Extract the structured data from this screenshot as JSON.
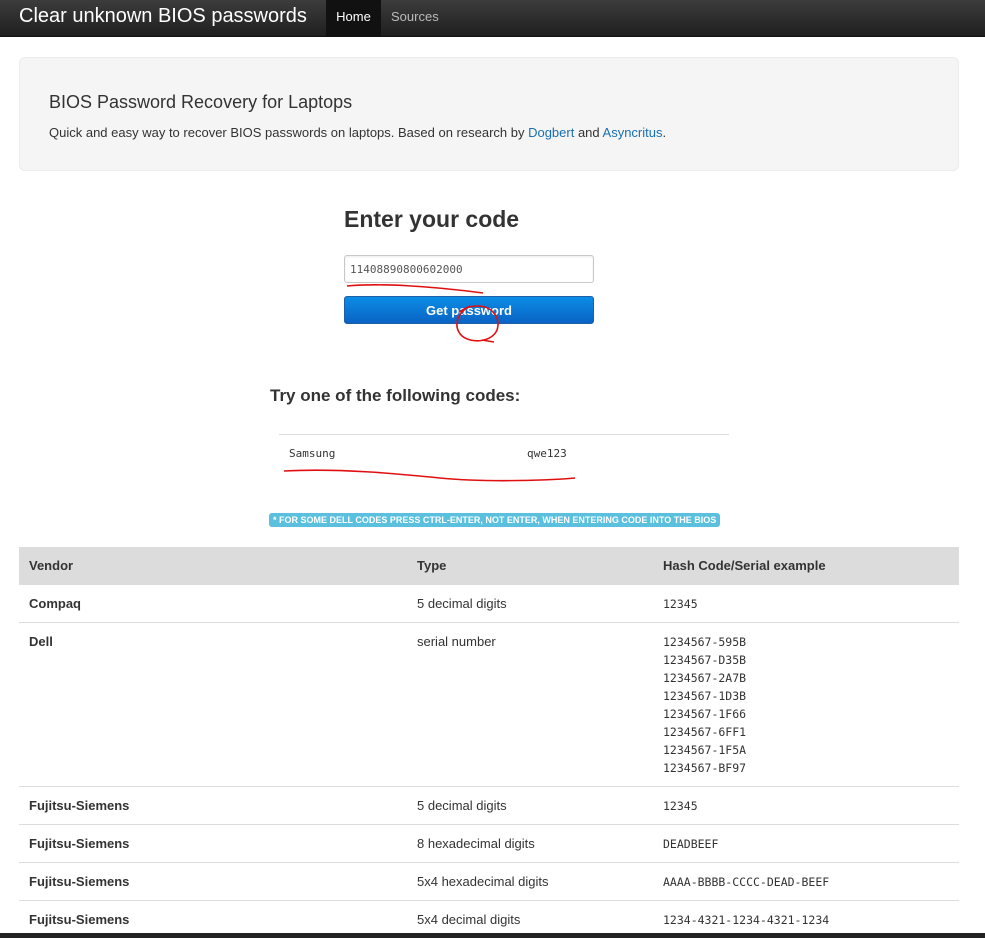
{
  "navbar": {
    "brand": "Clear unknown BIOS passwords",
    "tabs": [
      {
        "label": "Home",
        "active": true
      },
      {
        "label": "Sources",
        "active": false
      }
    ]
  },
  "hero": {
    "title": "BIOS Password Recovery for Laptops",
    "text_before": "Quick and easy way to recover BIOS passwords on laptops. Based on research by ",
    "link1": "Dogbert",
    "text_middle": " and ",
    "link2": "Asyncritus",
    "text_after": "."
  },
  "form": {
    "title": "Enter your code",
    "input_value": "11408890800602000",
    "button_label": "Get password"
  },
  "results": {
    "title": "Try one of the following codes:",
    "items": [
      {
        "vendor": "Samsung",
        "code": "qwe123"
      }
    ]
  },
  "notice": "* FOR SOME DELL CODES PRESS CTRL-ENTER, NOT ENTER, WHEN ENTERING CODE INTO THE BIOS",
  "table": {
    "headers": [
      "Vendor",
      "Type",
      "Hash Code/Serial example"
    ],
    "rows": [
      {
        "vendor": "Compaq",
        "type": "5 decimal digits",
        "hash": [
          "12345"
        ]
      },
      {
        "vendor": "Dell",
        "type": "serial number",
        "hash": [
          "1234567-595B",
          "1234567-D35B",
          "1234567-2A7B",
          "1234567-1D3B",
          "1234567-1F66",
          "1234567-6FF1",
          "1234567-1F5A",
          "1234567-BF97"
        ]
      },
      {
        "vendor": "Fujitsu-Siemens",
        "type": "5 decimal digits",
        "hash": [
          "12345"
        ]
      },
      {
        "vendor": "Fujitsu-Siemens",
        "type": "8 hexadecimal digits",
        "hash": [
          "DEADBEEF"
        ]
      },
      {
        "vendor": "Fujitsu-Siemens",
        "type": "5x4 hexadecimal digits",
        "hash": [
          "AAAA-BBBB-CCCC-DEAD-BEEF"
        ]
      },
      {
        "vendor": "Fujitsu-Siemens",
        "type": "5x4 decimal digits",
        "hash": [
          "1234-4321-1234-4321-1234"
        ]
      }
    ]
  },
  "colors": {
    "navbar": "#222222",
    "link": "#1a6fb3",
    "button": "#0a6fd0",
    "notice": "#5bc0de",
    "annotation": "#e01010"
  }
}
